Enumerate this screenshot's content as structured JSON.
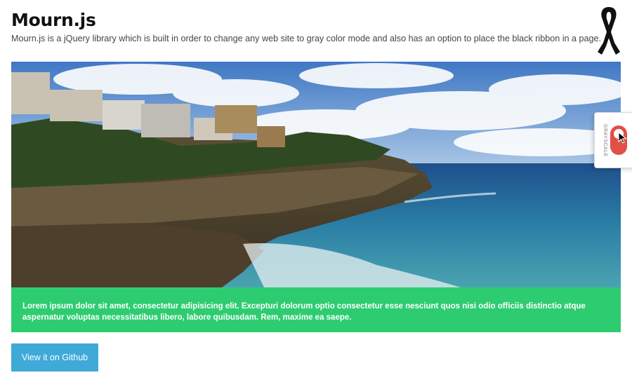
{
  "header": {
    "title": "Mourn.js",
    "subtitle": "Mourn.js is a jQuery library which is built in order to change any web site to gray color mode and also has an option to place the black ribbon in a page."
  },
  "icons": {
    "ribbon": "black-ribbon-icon",
    "cursor": "mouse-pointer-icon"
  },
  "hero": {
    "image": "coastal-cliff-photo"
  },
  "banner": {
    "text": "Lorem ipsum dolor sit amet, consectetur adipisicing elit. Excepturi dolorum optio consectetur esse nesciunt quos nisi odio officiis distinctio atque aspernatur voluptas necessitatibus libero, labore quibusdam. Rem, maxime ea saepe."
  },
  "github_button": {
    "label": "View it on Github"
  },
  "grayscale_panel": {
    "label": "GRAYSCALE",
    "toggle_on": true
  },
  "colors": {
    "banner_green": "#2ecc71",
    "button_blue": "#3fa9d8",
    "toggle_red": "#e05045"
  }
}
